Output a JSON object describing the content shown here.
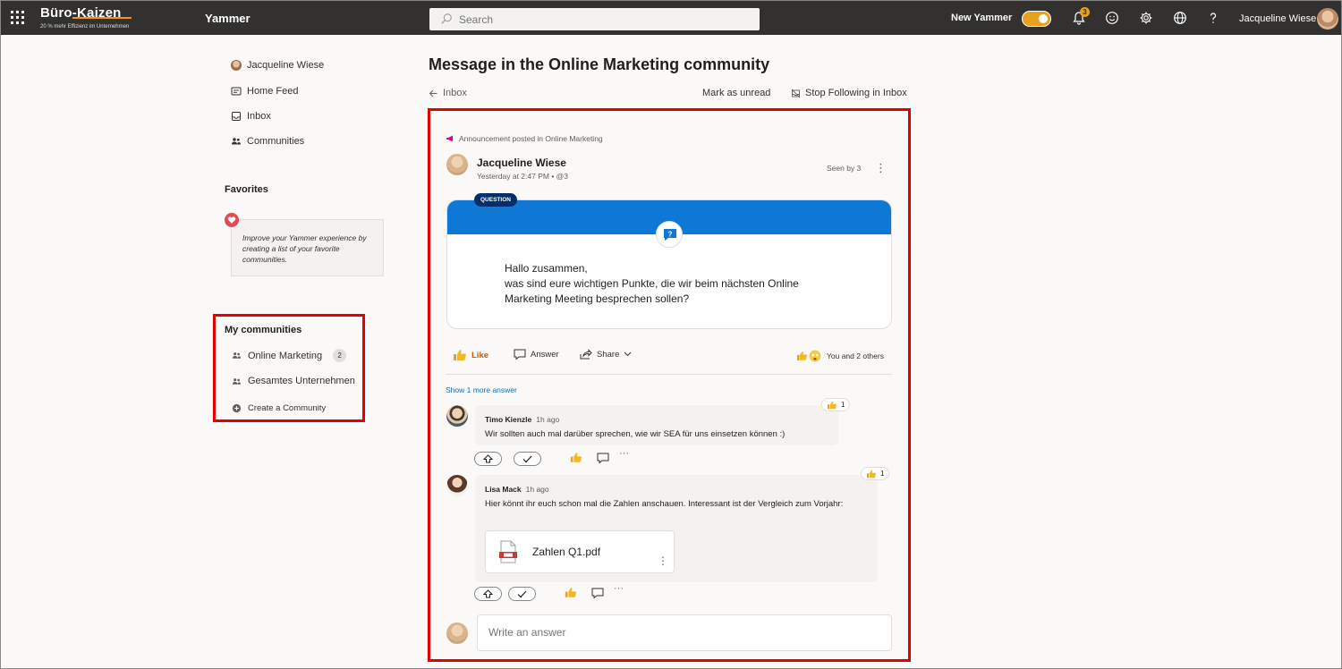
{
  "topbar": {
    "brand_name": "Büro-Kaizen",
    "brand_tagline": "20 % mehr Effizienz im Unternehmen",
    "app_name": "Yammer",
    "search_placeholder": "Search",
    "new_yammer_label": "New Yammer",
    "notification_count": "3",
    "user_name": "Jacqueline Wiese"
  },
  "sidebar": {
    "nav": [
      {
        "label": "Jacqueline Wiese"
      },
      {
        "label": "Home Feed"
      },
      {
        "label": "Inbox"
      },
      {
        "label": "Communities"
      }
    ],
    "favorites_heading": "Favorites",
    "favorites_hint": "Improve your Yammer experience by creating a list of your favorite communities.",
    "my_communities_heading": "My communities",
    "communities": [
      {
        "label": "Online Marketing",
        "count": "2"
      },
      {
        "label": "Gesamtes Unternehmen"
      }
    ],
    "create_community": "Create a Community"
  },
  "main": {
    "title": "Message in the Online Marketing community",
    "back_label": "Inbox",
    "mark_unread": "Mark as unread",
    "stop_following": "Stop Following in Inbox",
    "post": {
      "label": "Announcement posted in Online Marketing",
      "author": "Jacqueline Wiese",
      "meta": "Yesterday at 2:47 PM  •  @3",
      "seen_by": "Seen by 3",
      "pill": "QUESTION",
      "body_line1": "Hallo zusammen,",
      "body_line2": "was sind eure wichtigen Punkte, die wir beim nächsten Online Marketing Meeting besprechen sollen?",
      "like": "Like",
      "answer": "Answer",
      "share": "Share",
      "reactions_summary": "You and 2 others"
    },
    "show_more": "Show 1 more answer",
    "comments": [
      {
        "author": "Timo Kienzle",
        "time": "1h ago",
        "text": "Wir sollten auch mal darüber sprechen, wie wir SEA für uns einsetzen können :)",
        "reaction_count": "1"
      },
      {
        "author": "Lisa Mack",
        "time": "1h ago",
        "text": "Hier könnt ihr euch schon mal die Zahlen anschauen. Interessant ist der Vergleich zum Vorjahr:",
        "reaction_count": "1",
        "file_name": "Zahlen Q1.pdf"
      }
    ],
    "reply_placeholder": "Write an answer"
  },
  "colors": {
    "accent_blue": "#0f78d4",
    "highlight_red": "#e50000",
    "toggle_orange": "#e6a21f",
    "like_orange": "#c75b12"
  }
}
